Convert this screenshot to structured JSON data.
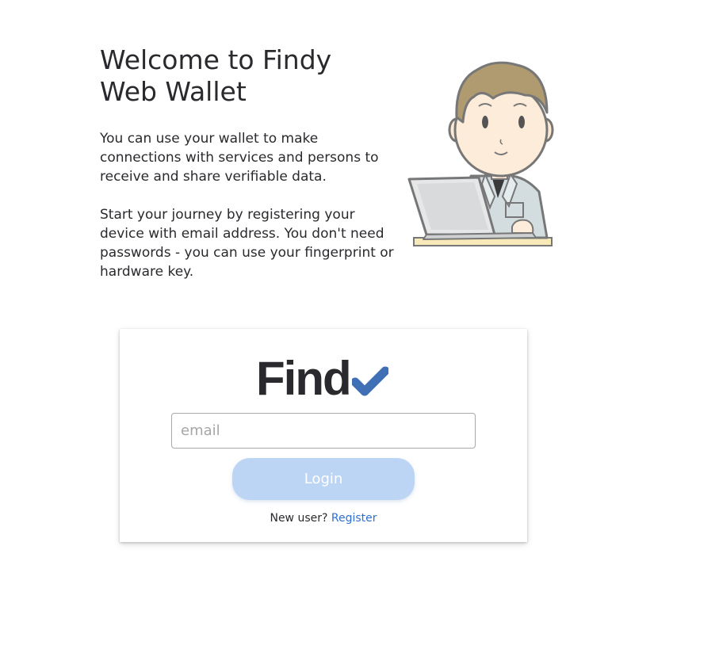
{
  "intro": {
    "title": "Welcome to Findy Web Wallet",
    "paragraph_1": "You can use your wallet to make connections with services and persons to receive and share verifiable data.",
    "paragraph_2": "Start your journey by registering your device with email address. You don't need passwords - you can use your fingerprint or hardware key."
  },
  "illustration": {
    "icon": "person-at-laptop-illustration"
  },
  "login_card": {
    "logo_text": "Find",
    "logo_icon": "checkmark-icon",
    "email_placeholder": "email",
    "email_value": "",
    "login_label": "Login",
    "new_user_text": "New user?",
    "register_label": "Register"
  },
  "colors": {
    "brand_check": "#3f6fb5",
    "login_button_disabled": "#bdd5f5",
    "link": "#2f6fd1",
    "text": "#2a2a2e"
  }
}
